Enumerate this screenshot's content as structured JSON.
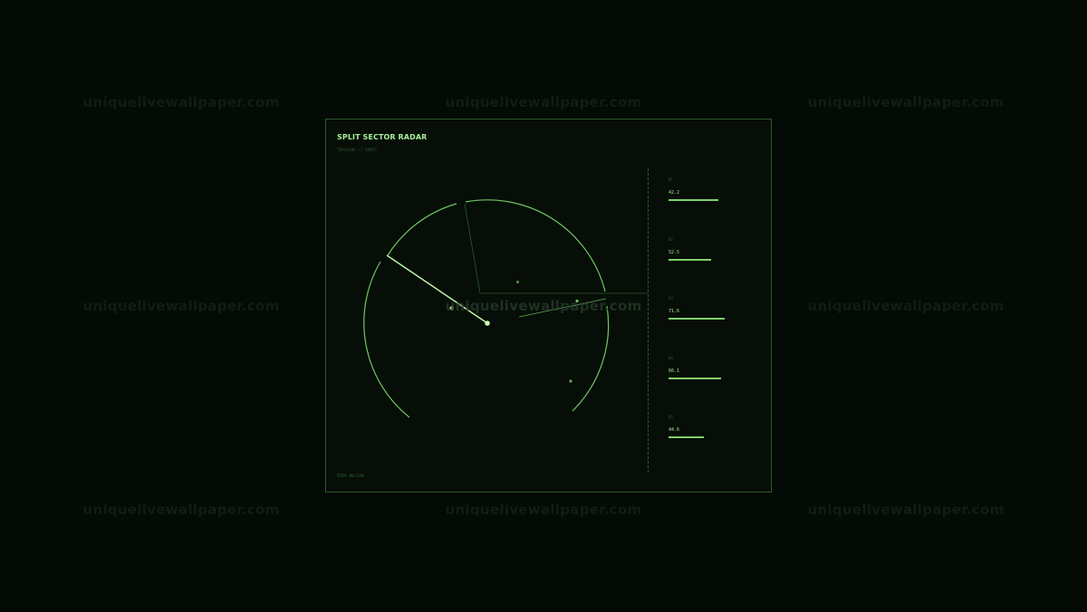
{
  "watermark": "uniquelivewallpaper.com",
  "panel": {
    "title": "SPLIT SECTOR RADAR",
    "subtitle": "TRACKING // ORBIT",
    "footer": "STEP 86/120"
  },
  "readouts": [
    {
      "label": "01",
      "value": "42.2",
      "level": 0.422
    },
    {
      "label": "02",
      "value": "52.5",
      "level": 0.365
    },
    {
      "label": "03",
      "value": "71.6",
      "level": 0.476
    },
    {
      "label": "04",
      "value": "66.1",
      "level": 0.446
    },
    {
      "label": "05",
      "value": "44.6",
      "level": 0.3
    }
  ],
  "colors": {
    "background": "#040a05",
    "panel_border": "#2c5a2c",
    "accent": "#8ee07a",
    "bright": "#c9ffb4"
  }
}
